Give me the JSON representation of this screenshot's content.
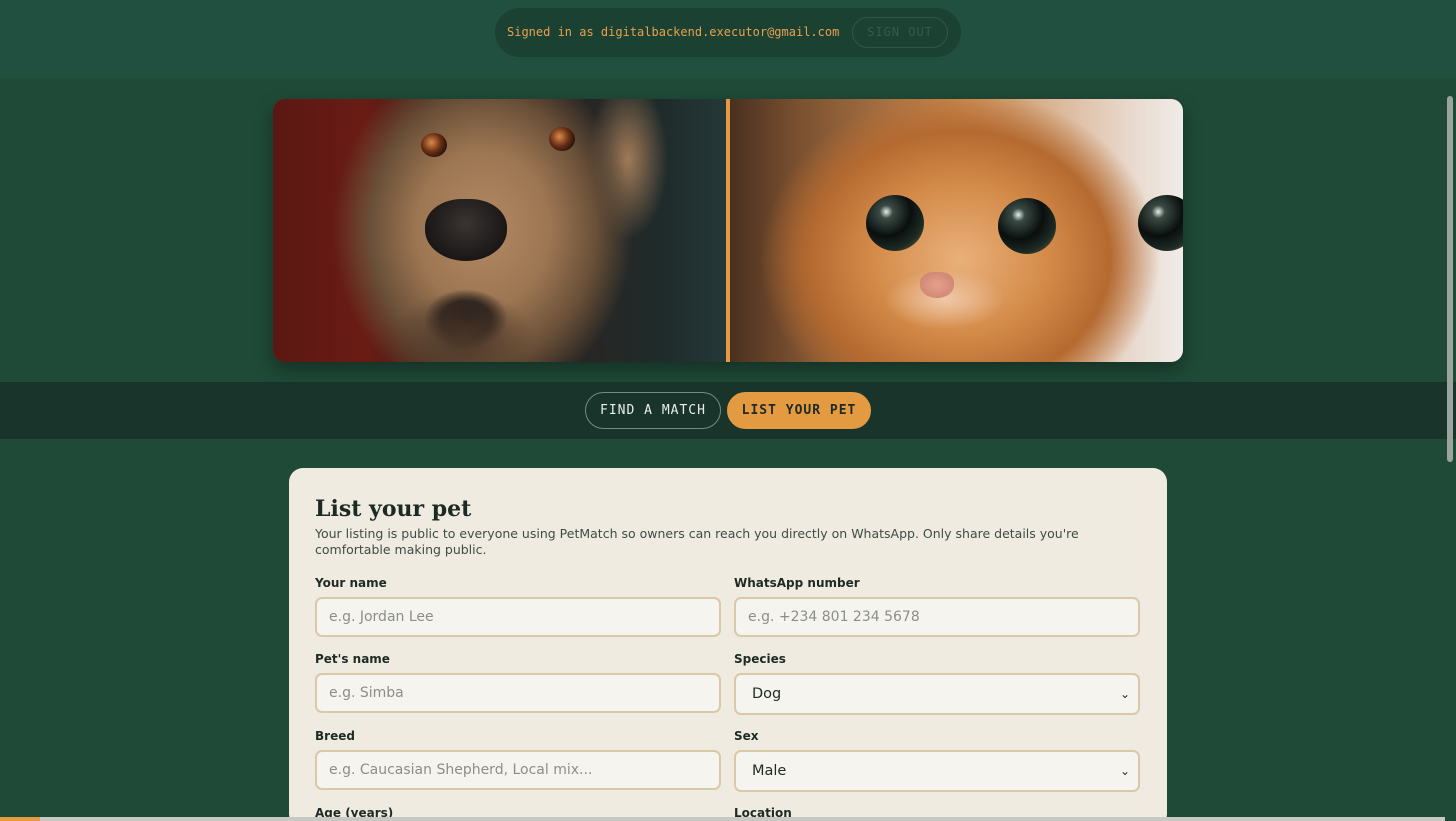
{
  "header": {
    "signed_in_text": "Signed in as digitalbackend.executor@gmail.com",
    "sign_out_label": "SIGN OUT"
  },
  "hero": {
    "left_image": "dog-photo",
    "right_image": "cat-photo"
  },
  "nav": {
    "find_label": "FIND A MATCH",
    "list_label": "LIST YOUR PET",
    "active": "LIST YOUR PET"
  },
  "form": {
    "title": "List your pet",
    "description": "Your listing is public to everyone using PetMatch so owners can reach you directly on WhatsApp. Only share details you're comfortable making public.",
    "fields": {
      "your_name": {
        "label": "Your name",
        "placeholder": "e.g. Jordan Lee"
      },
      "whatsapp": {
        "label": "WhatsApp number",
        "placeholder": "e.g. +234 801 234 5678"
      },
      "pet_name": {
        "label": "Pet's name",
        "placeholder": "e.g. Simba"
      },
      "species": {
        "label": "Species",
        "value": "Dog"
      },
      "breed": {
        "label": "Breed",
        "placeholder": "e.g. Caucasian Shepherd, Local mix..."
      },
      "sex": {
        "label": "Sex",
        "value": "Male"
      },
      "age": {
        "label": "Age (years)"
      },
      "location": {
        "label": "Location"
      }
    }
  },
  "colors": {
    "background": "#1f4a38",
    "accent": "#e39a40",
    "card": "#efebe0"
  }
}
